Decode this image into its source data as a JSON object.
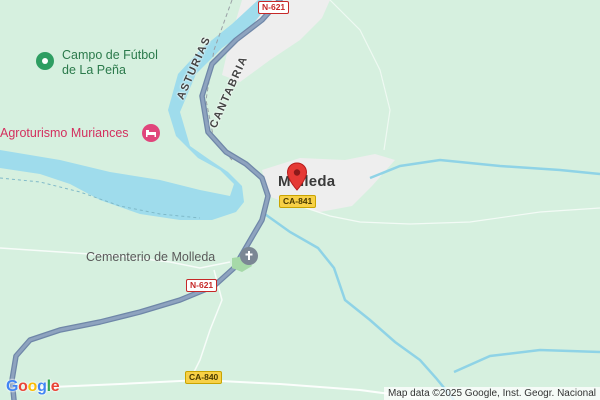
{
  "places": {
    "town": "Molleda",
    "cemetery": "Cementerio de Molleda",
    "football_line1": "Campo de Fútbol",
    "football_line2": "de La Peña",
    "hotel": "Agroturismo Muriances"
  },
  "regions": {
    "asturias": "ASTURIAS",
    "cantabria": "CANTABRIA"
  },
  "roads": {
    "n621_top": "N-621",
    "n621_bottom": "N-621",
    "ca841": "CA-841",
    "ca840": "CA-840"
  },
  "colors": {
    "land": "#d6f0df",
    "water": "#9fdcec",
    "road_main": "#7f95b2",
    "pin": "#e53935",
    "urban": "#eeeeee"
  },
  "icons": {
    "pin": "location-pin-icon",
    "football": "park-pin-icon",
    "hotel": "bed-icon",
    "cemetery": "cemetery-icon"
  },
  "branding": {
    "logo": "Google",
    "attribution": "Map data ©2025 Google, Inst. Geogr. Nacional"
  }
}
